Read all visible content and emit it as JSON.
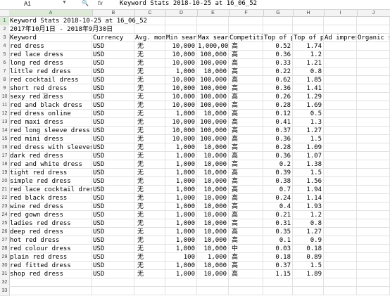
{
  "formula_bar": {
    "name_box": "A1",
    "formula_text": "Keyword Stats 2018-10-25 at 16_06_52",
    "icons": [
      "search-icon",
      "fx-icon"
    ]
  },
  "columns": [
    "A",
    "B",
    "C",
    "D",
    "E",
    "F",
    "G",
    "H",
    "I",
    "J"
  ],
  "header_row": [
    "Keyword",
    "Currency",
    "Avg. month",
    "Min search",
    "Max search",
    "Competitio",
    "Top of pag",
    "Top of pag",
    "Ad impress",
    "Organic se"
  ],
  "title_cell": "Keyword Stats 2018-10-25 at 16_06_52",
  "date_range_cell": "2017年10月1日 - 2018年9月30日",
  "rows": [
    [
      "red dress",
      "USD",
      "无",
      "10,000",
      "1,000,000",
      "高",
      "0.52",
      "1.74"
    ],
    [
      "red lace dress",
      "USD",
      "无",
      "10,000",
      "100,000",
      "高",
      "0.36",
      "1.2"
    ],
    [
      "long red dress",
      "USD",
      "无",
      "10,000",
      "100,000",
      "高",
      "0.33",
      "1.21"
    ],
    [
      "little red dress",
      "USD",
      "无",
      "1,000",
      "10,000",
      "高",
      "0.22",
      "0.8"
    ],
    [
      "red cocktail dress",
      "USD",
      "无",
      "10,000",
      "100,000",
      "高",
      "0.62",
      "1.85"
    ],
    [
      "short red dress",
      "USD",
      "无",
      "10,000",
      "100,000",
      "高",
      "0.36",
      "1.41"
    ],
    [
      "sexy red dress",
      "USD",
      "无",
      "10,000",
      "100,000",
      "高",
      "0.26",
      "1.29"
    ],
    [
      "red and black dress",
      "USD",
      "无",
      "10,000",
      "100,000",
      "高",
      "0.28",
      "1.69"
    ],
    [
      "red dress online",
      "USD",
      "无",
      "1,000",
      "10,000",
      "高",
      "0.12",
      "0.5"
    ],
    [
      "red maxi dress",
      "USD",
      "无",
      "10,000",
      "100,000",
      "高",
      "0.41",
      "1.3"
    ],
    [
      "red long sleeve dress",
      "USD",
      "无",
      "10,000",
      "100,000",
      "高",
      "0.37",
      "1.27"
    ],
    [
      "red mini dress",
      "USD",
      "无",
      "10,000",
      "100,000",
      "高",
      "0.36",
      "1.5"
    ],
    [
      "red dress with sleeves",
      "USD",
      "无",
      "1,000",
      "10,000",
      "高",
      "0.28",
      "1.09"
    ],
    [
      "dark red dress",
      "USD",
      "无",
      "1,000",
      "10,000",
      "高",
      "0.36",
      "1.07"
    ],
    [
      "red and white dress",
      "USD",
      "无",
      "1,000",
      "10,000",
      "高",
      "0.2",
      "1.38"
    ],
    [
      "tight red dress",
      "USD",
      "无",
      "1,000",
      "10,000",
      "高",
      "0.39",
      "1.5"
    ],
    [
      "simple red dress",
      "USD",
      "无",
      "1,000",
      "10,000",
      "高",
      "0.38",
      "1.56"
    ],
    [
      "red lace cocktail dress",
      "USD",
      "无",
      "1,000",
      "10,000",
      "高",
      "0.7",
      "1.94"
    ],
    [
      "red black dress",
      "USD",
      "无",
      "1,000",
      "10,000",
      "高",
      "0.24",
      "1.14"
    ],
    [
      "wine red dress",
      "USD",
      "无",
      "1,000",
      "10,000",
      "高",
      "0.4",
      "1.93"
    ],
    [
      "red gown dress",
      "USD",
      "无",
      "1,000",
      "10,000",
      "高",
      "0.21",
      "1.2"
    ],
    [
      "ladies red dress",
      "USD",
      "无",
      "1,000",
      "10,000",
      "高",
      "0.31",
      "0.8"
    ],
    [
      "deep red dress",
      "USD",
      "无",
      "1,000",
      "10,000",
      "高",
      "0.35",
      "1.27"
    ],
    [
      "hot red dress",
      "USD",
      "无",
      "1,000",
      "10,000",
      "高",
      "0.1",
      "0.9"
    ],
    [
      "red colour dress",
      "USD",
      "无",
      "1,000",
      "10,000",
      "中",
      "0.03",
      "0.18"
    ],
    [
      "plain red dress",
      "USD",
      "无",
      "100",
      "1,000",
      "高",
      "0.18",
      "0.89"
    ],
    [
      "red fitted dress",
      "USD",
      "无",
      "1,000",
      "10,000",
      "高",
      "0.37",
      "1.5"
    ],
    [
      "shop red dress",
      "USD",
      "无",
      "1,000",
      "10,000",
      "高",
      "1.15",
      "1.89"
    ]
  ]
}
